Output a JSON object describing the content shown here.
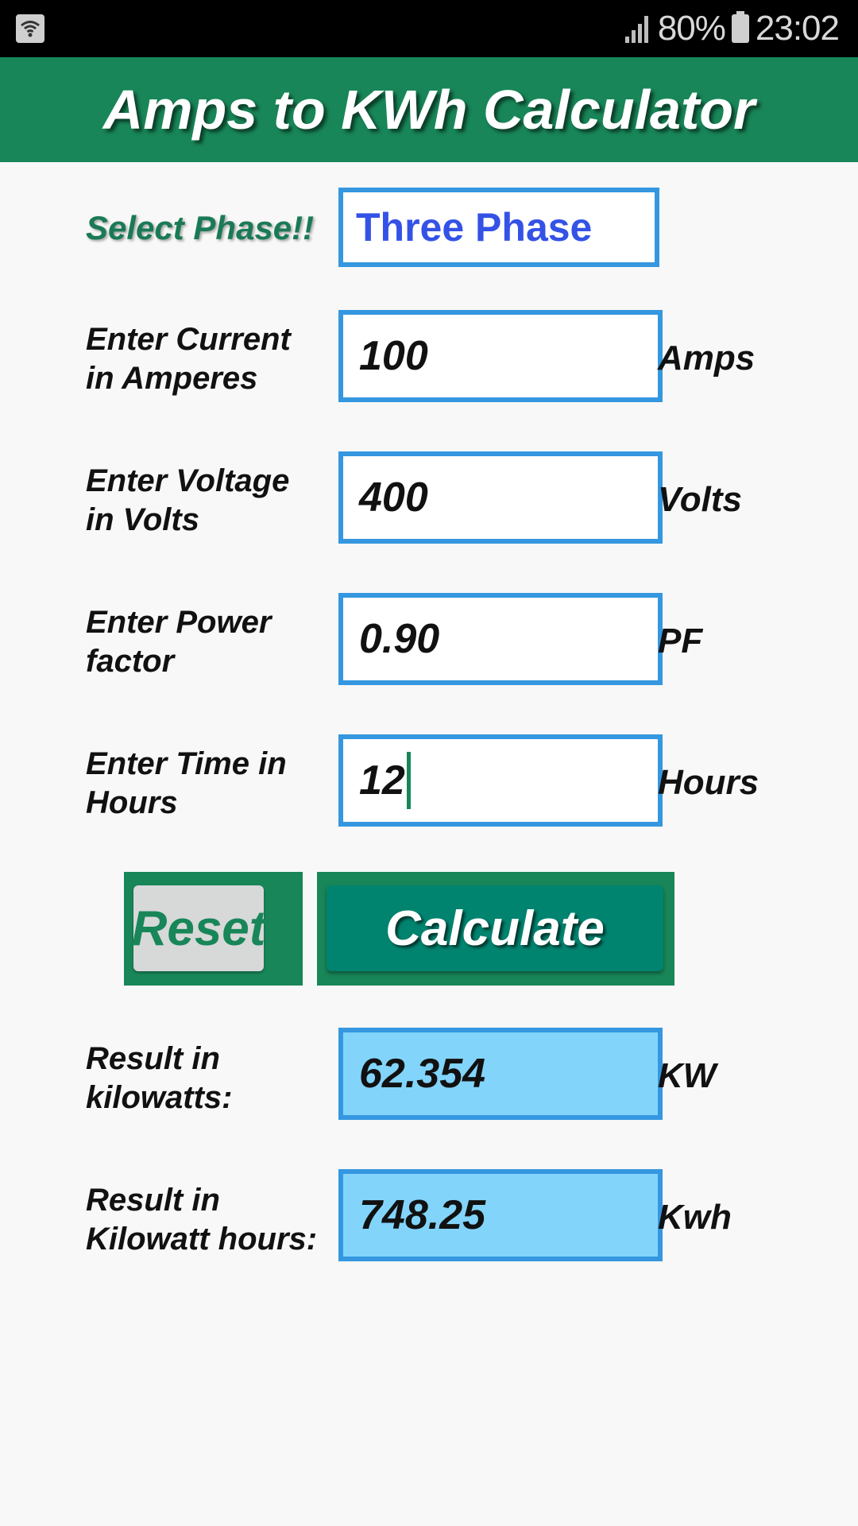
{
  "status_bar": {
    "battery_percent": "80%",
    "time": "23:02",
    "icons": [
      "wifi-icon",
      "signal-icon",
      "battery-charging-icon"
    ]
  },
  "app_bar": {
    "title": "Amps to KWh Calculator"
  },
  "form": {
    "phase": {
      "label": "Select Phase!!",
      "value": "Three Phase"
    },
    "current": {
      "label": "Enter Current in Amperes",
      "value": "100",
      "unit": "Amps"
    },
    "voltage": {
      "label": "Enter Voltage in Volts",
      "value": "400",
      "unit": "Volts"
    },
    "power_factor": {
      "label": "Enter Power factor",
      "value": "0.90",
      "unit": "PF"
    },
    "time": {
      "label": "Enter Time in Hours",
      "value": "12",
      "unit": "Hours"
    }
  },
  "buttons": {
    "reset": "Reset",
    "calculate": "Calculate"
  },
  "results": {
    "kilowatts": {
      "label": "Result in kilowatts:",
      "value": "62.354",
      "unit": "KW"
    },
    "kilowatt_hours": {
      "label": "Result in Kilowatt hours:",
      "value": "748.25",
      "unit": "Kwh"
    }
  },
  "colors": {
    "primary_green": "#188658",
    "calculate_teal": "#00836f",
    "field_border": "#3597e0",
    "result_bg": "#82d4fa",
    "phase_text": "#3452e6"
  }
}
